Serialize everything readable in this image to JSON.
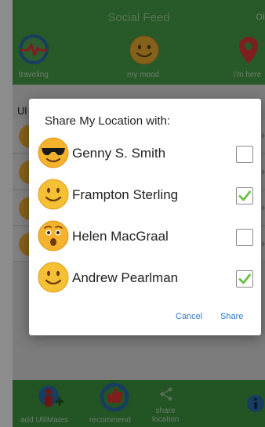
{
  "header": {
    "title": "Social Feed",
    "corner_text": "OI",
    "items": [
      {
        "label": "traveling",
        "icon": "heartbeat-icon"
      },
      {
        "label": "my mood",
        "icon": "smiley-icon"
      },
      {
        "label": "i'm here",
        "icon": "location-pin-icon"
      }
    ]
  },
  "content": {
    "section_label": "Ul"
  },
  "footer": {
    "items": [
      {
        "label": "add UltiMates",
        "icon": "add-person-icon"
      },
      {
        "label": "recommend",
        "icon": "thumbs-up-icon"
      },
      {
        "label_line1": "share",
        "label_line2": "location",
        "icon": "share-icon"
      },
      {
        "label": "",
        "icon": "info-icon"
      }
    ]
  },
  "dialog": {
    "title": "Share My Location with:",
    "contacts": [
      {
        "name": "Genny S. Smith",
        "emoji": "sunglasses-face-icon",
        "checked": false
      },
      {
        "name": "Frampton Sterling",
        "emoji": "smiling-face-icon",
        "checked": true
      },
      {
        "name": "Helen MacGraal",
        "emoji": "surprised-face-icon",
        "checked": false
      },
      {
        "name": "Andrew Pearlman",
        "emoji": "smiling-face-icon",
        "checked": true
      }
    ],
    "cancel_label": "Cancel",
    "share_label": "Share"
  },
  "colors": {
    "header_green": "#49a24a",
    "footer_green": "#3f9a42",
    "check_green": "#6cc24a",
    "action_blue": "#2f7cc6",
    "pin_red": "#e53935"
  }
}
